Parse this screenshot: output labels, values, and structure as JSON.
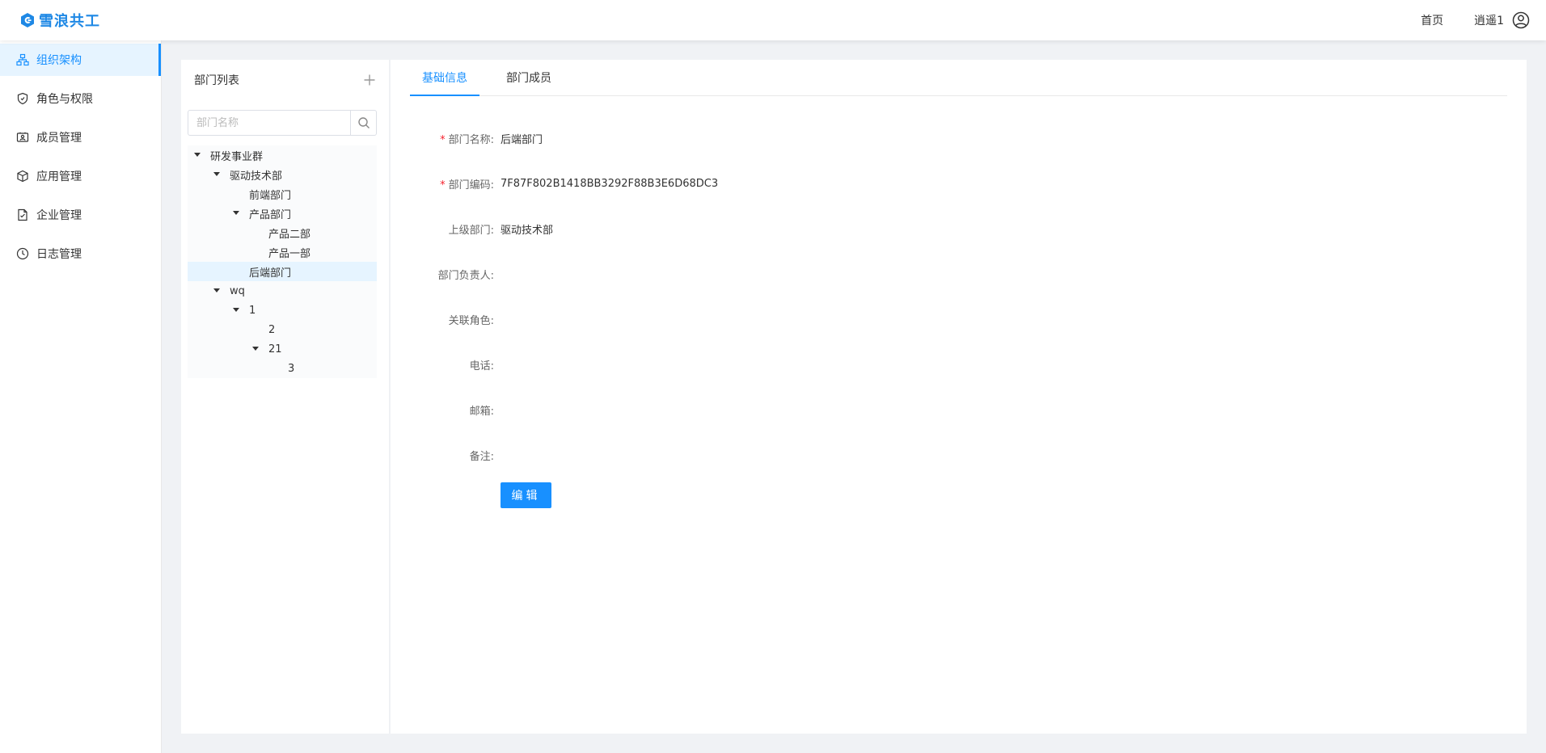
{
  "header": {
    "logo_text": "雪浪共工",
    "home_link": "首页",
    "username": "逍遥1"
  },
  "sidebar": {
    "items": [
      {
        "label": "组织架构",
        "icon": "org-chart-icon",
        "active": true
      },
      {
        "label": "角色与权限",
        "icon": "shield-icon",
        "active": false
      },
      {
        "label": "成员管理",
        "icon": "id-card-icon",
        "active": false
      },
      {
        "label": "应用管理",
        "icon": "cube-icon",
        "active": false
      },
      {
        "label": "企业管理",
        "icon": "document-icon",
        "active": false
      },
      {
        "label": "日志管理",
        "icon": "clock-icon",
        "active": false
      }
    ]
  },
  "dept_panel": {
    "title": "部门列表",
    "search_placeholder": "部门名称",
    "tree": [
      {
        "label": "研发事业群",
        "level": 0,
        "expanded": true
      },
      {
        "label": "驱动技术部",
        "level": 1,
        "expanded": true
      },
      {
        "label": "前端部门",
        "level": 2,
        "expanded": null
      },
      {
        "label": "产品部门",
        "level": 2,
        "expanded": true
      },
      {
        "label": "产品二部",
        "level": 3,
        "expanded": null
      },
      {
        "label": "产品一部",
        "level": 3,
        "expanded": null
      },
      {
        "label": "后端部门",
        "level": 2,
        "expanded": null,
        "selected": true
      },
      {
        "label": "wq",
        "level": 1,
        "expanded": true
      },
      {
        "label": "1",
        "level": 2,
        "expanded": true
      },
      {
        "label": "2",
        "level": 3,
        "expanded": null
      },
      {
        "label": "21",
        "level": 3,
        "expanded": true
      },
      {
        "label": "3",
        "level": 4,
        "expanded": null
      }
    ]
  },
  "main": {
    "tabs": [
      {
        "label": "基础信息",
        "active": true
      },
      {
        "label": "部门成员",
        "active": false
      }
    ],
    "form": {
      "dept_name_label": "部门名称:",
      "dept_name_value": "后端部门",
      "dept_code_label": "部门编码:",
      "dept_code_value": "7F87F802B1418BB3292F88B3E6D68DC3",
      "parent_label": "上级部门:",
      "parent_value": "驱动技术部",
      "leader_label": "部门负责人:",
      "leader_value": "",
      "role_label": "关联角色:",
      "role_value": "",
      "phone_label": "电话:",
      "phone_value": "",
      "email_label": "邮箱:",
      "email_value": "",
      "note_label": "备注:",
      "note_value": ""
    },
    "edit_button": "编辑"
  },
  "colors": {
    "primary": "#1890ff",
    "active_bg": "#e6f4ff",
    "required": "#f5222d"
  }
}
